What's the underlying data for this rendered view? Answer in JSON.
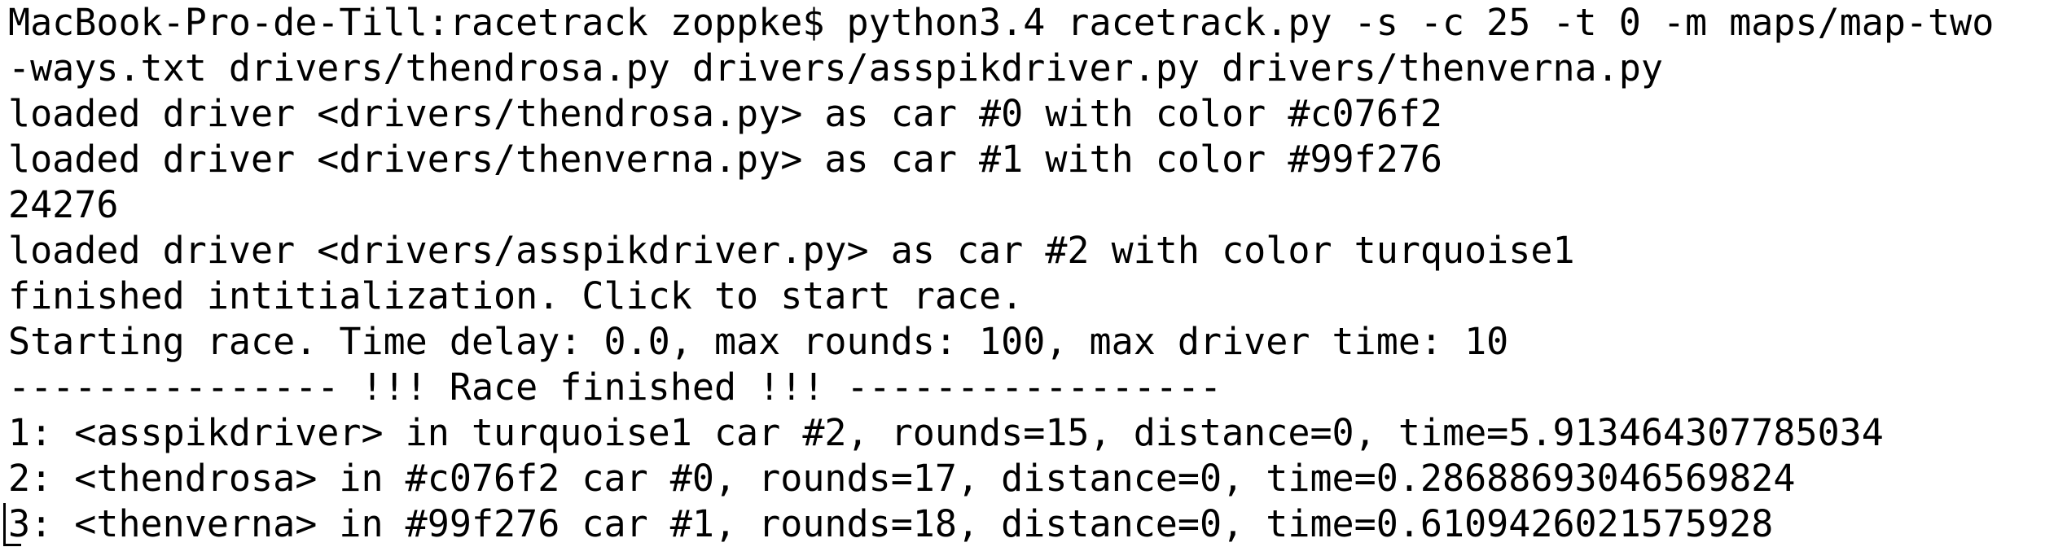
{
  "terminal": {
    "lines": [
      "MacBook-Pro-de-Till:racetrack zoppke$ python3.4 racetrack.py -s -c 25 -t 0 -m maps/map-two",
      "-ways.txt drivers/thendrosa.py drivers/asspikdriver.py drivers/thenverna.py",
      "loaded driver <drivers/thendrosa.py> as car #0 with color #c076f2",
      "loaded driver <drivers/thenverna.py> as car #1 with color #99f276",
      "24276",
      "loaded driver <drivers/asspikdriver.py> as car #2 with color turquoise1",
      "finished intitialization. Click to start race.",
      "Starting race. Time delay: 0.0, max rounds: 100, max driver time: 10",
      "--------------- !!! Race finished !!! -----------------",
      "1: <asspikdriver> in turquoise1 car #2, rounds=15, distance=0, time=5.913464307785034",
      "2: <thendrosa> in #c076f2 car #0, rounds=17, distance=0, time=0.2868869304656982​4",
      "3: <thenverna> in #99f276 car #1, rounds=18, distance=0, time=0.6109426021575928"
    ]
  },
  "colors": {
    "background": "#ffffff",
    "text": "#000000"
  }
}
